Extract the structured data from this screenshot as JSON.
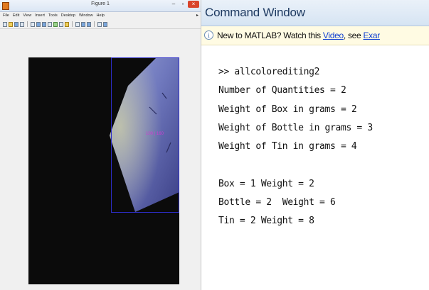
{
  "figure": {
    "title": "Figure 1",
    "menu": [
      "File",
      "Edit",
      "View",
      "Insert",
      "Tools",
      "Desktop",
      "Window",
      "Help"
    ],
    "detection_label": "100 | 160"
  },
  "command_window": {
    "title": "Command Window",
    "info": {
      "prefix": "New to MATLAB? Watch this ",
      "link1": "Video",
      "middle": ", see ",
      "link2": "Exar"
    },
    "lines": [
      ">> allcolorediting2",
      "Number of Quantities = 2",
      "Weight of Box in grams = 2",
      "Weight of Bottle in grams = 3",
      "Weight of Tin in grams = 4",
      "",
      "Box = 1 Weight = 2",
      "Bottle = 2  Weight = 6",
      "Tin = 2 Weight = 8"
    ]
  },
  "colors": {
    "accent": "#1e3a61",
    "link": "#0f3fd1",
    "bbox": "#2d2dc8",
    "label": "#d23ad2"
  }
}
